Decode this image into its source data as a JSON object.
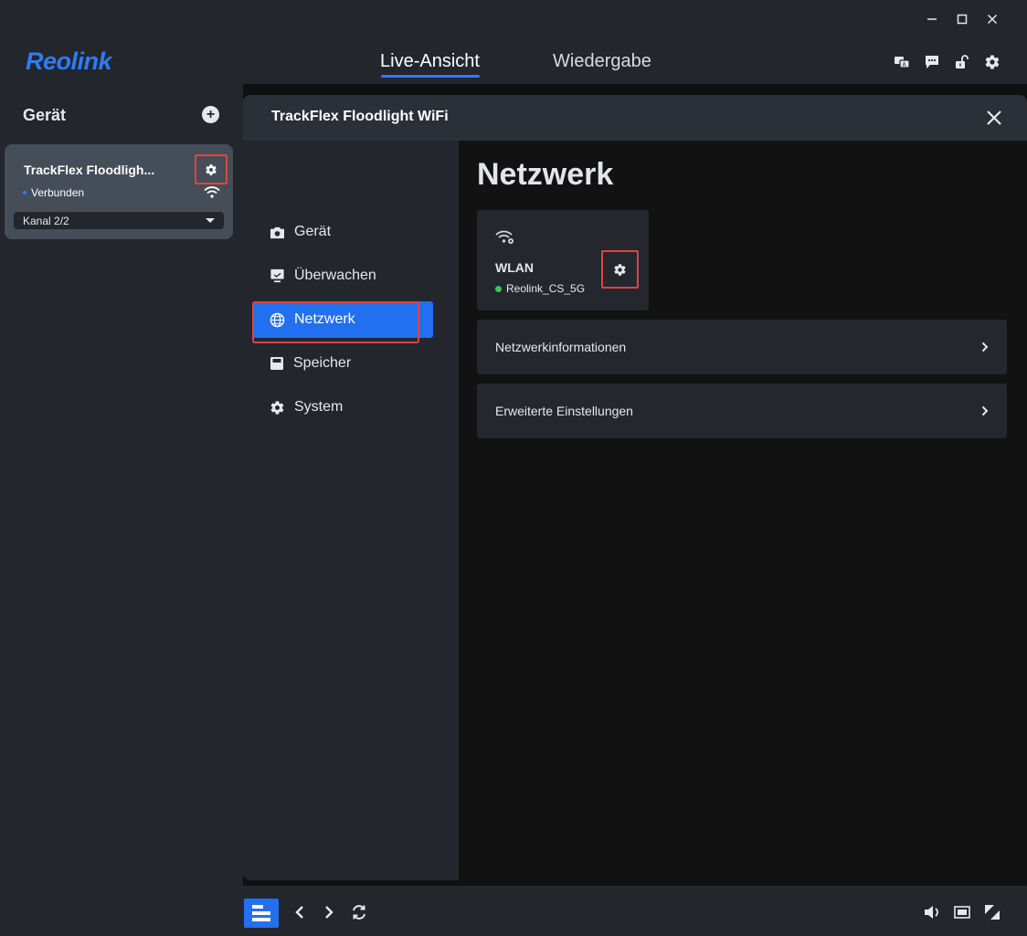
{
  "app": {
    "logo": "Reolink"
  },
  "window_controls": [
    "minimize-icon",
    "maximize-icon",
    "close-icon"
  ],
  "nav": {
    "tabs": [
      {
        "label": "Live-Ansicht",
        "active": true
      },
      {
        "label": "Wiedergabe",
        "active": false
      }
    ],
    "icons": [
      "translate-icon",
      "message-icon",
      "unlock-icon",
      "gear-icon"
    ]
  },
  "sidebar": {
    "title": "Gerät",
    "device": {
      "name": "TrackFlex Floodligh...",
      "status": "Verbunden",
      "channel": "Kanal 2/2"
    }
  },
  "dialog": {
    "title": "TrackFlex Floodlight WiFi",
    "menu": [
      {
        "label": "Gerät",
        "icon": "camera-icon",
        "active": false
      },
      {
        "label": "Überwachen",
        "icon": "monitor-icon",
        "active": false
      },
      {
        "label": "Netzwerk",
        "icon": "globe-icon",
        "active": true
      },
      {
        "label": "Speicher",
        "icon": "storage-icon",
        "active": false
      },
      {
        "label": "System",
        "icon": "gear-icon",
        "active": false
      }
    ],
    "content": {
      "title": "Netzwerk",
      "wlan": {
        "label": "WLAN",
        "ssid": "Reolink_CS_5G"
      },
      "rows": [
        {
          "label": "Netzwerkinformationen"
        },
        {
          "label": "Erweiterte Einstellungen"
        }
      ]
    }
  },
  "colors": {
    "accent": "#2270f0",
    "highlight": "#e0443e",
    "status_connected": "#3cc45e"
  }
}
